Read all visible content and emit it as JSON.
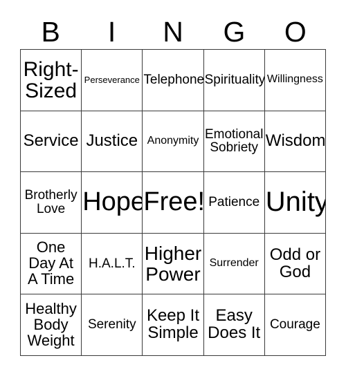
{
  "card": {
    "title": "BINGO",
    "header_letters": [
      "B",
      "I",
      "N",
      "G",
      "O"
    ],
    "columns": 5,
    "rows": 5,
    "border_color": "#3a3a3a",
    "background_color": "#ffffff",
    "text_color": "#000000"
  },
  "cells": [
    {
      "text": "Right-\nSized",
      "size": "fs-lg",
      "row": 1,
      "col": 1
    },
    {
      "text": "Perseverance",
      "size": "fs-mini",
      "row": 1,
      "col": 2
    },
    {
      "text": "Telephone",
      "size": "fs-xxs",
      "row": 1,
      "col": 3
    },
    {
      "text": "Spirituality",
      "size": "fs-xxs",
      "row": 1,
      "col": 4
    },
    {
      "text": "Willingness",
      "size": "fs-tiny",
      "row": 1,
      "col": 5
    },
    {
      "text": "Service",
      "size": "fs-sm",
      "row": 2,
      "col": 1
    },
    {
      "text": "Justice",
      "size": "fs-sm",
      "row": 2,
      "col": 2
    },
    {
      "text": "Anonymity",
      "size": "fs-tiny",
      "row": 2,
      "col": 3
    },
    {
      "text": "Emotional\nSobriety",
      "size": "fs-xxs",
      "row": 2,
      "col": 4
    },
    {
      "text": "Wisdom",
      "size": "fs-sm",
      "row": 2,
      "col": 5
    },
    {
      "text": "Brotherly\nLove",
      "size": "fs-xxs",
      "row": 3,
      "col": 1
    },
    {
      "text": "Hope",
      "size": "fs-xl",
      "row": 3,
      "col": 2
    },
    {
      "text": "Free!",
      "size": "fs-xl",
      "row": 3,
      "col": 3
    },
    {
      "text": "Patience",
      "size": "fs-xxs",
      "row": 3,
      "col": 4
    },
    {
      "text": "Unity",
      "size": "fs-xxl",
      "row": 3,
      "col": 5
    },
    {
      "text": "One\nDay At\nA Time",
      "size": "fs-xs",
      "row": 4,
      "col": 1
    },
    {
      "text": "H.A.L.T.",
      "size": "fs-xxs",
      "row": 4,
      "col": 2
    },
    {
      "text": "Higher\nPower",
      "size": "fs-md",
      "row": 4,
      "col": 3
    },
    {
      "text": "Surrender",
      "size": "fs-tiny",
      "row": 4,
      "col": 4
    },
    {
      "text": "Odd or\nGod",
      "size": "fs-sm",
      "row": 4,
      "col": 5
    },
    {
      "text": "Healthy\nBody\nWeight",
      "size": "fs-xs",
      "row": 5,
      "col": 1
    },
    {
      "text": "Serenity",
      "size": "fs-xxs",
      "row": 5,
      "col": 2
    },
    {
      "text": "Keep It\nSimple",
      "size": "fs-sm",
      "row": 5,
      "col": 3
    },
    {
      "text": "Easy\nDoes It",
      "size": "fs-sm",
      "row": 5,
      "col": 4
    },
    {
      "text": "Courage",
      "size": "fs-xxs",
      "row": 5,
      "col": 5
    }
  ]
}
